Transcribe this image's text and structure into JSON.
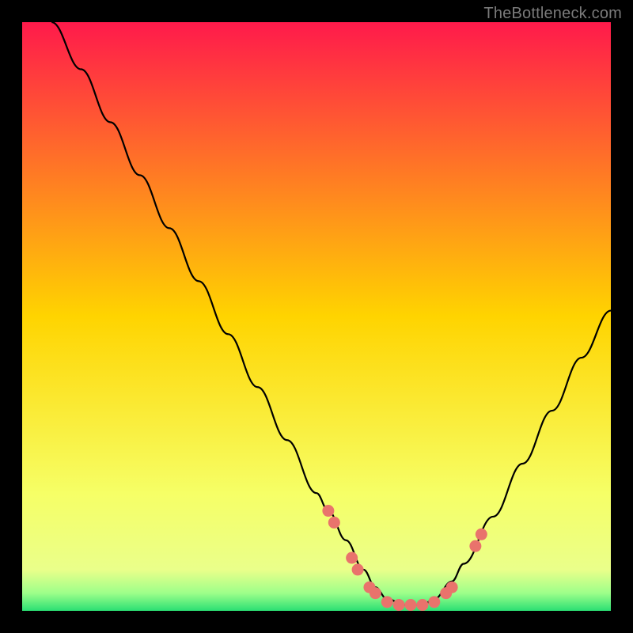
{
  "watermark": "TheBottleneck.com",
  "chart_data": {
    "type": "line",
    "title": "",
    "xlabel": "",
    "ylabel": "",
    "xlim": [
      0,
      100
    ],
    "ylim": [
      0,
      100
    ],
    "gradient_stops": [
      {
        "offset": 0.0,
        "color": "#ff1a4b"
      },
      {
        "offset": 0.5,
        "color": "#ffd400"
      },
      {
        "offset": 0.8,
        "color": "#f6ff66"
      },
      {
        "offset": 0.93,
        "color": "#eaff8a"
      },
      {
        "offset": 0.97,
        "color": "#9dff8a"
      },
      {
        "offset": 1.0,
        "color": "#2bdf74"
      }
    ],
    "series": [
      {
        "name": "bottleneck-curve",
        "x": [
          5,
          10,
          15,
          20,
          25,
          30,
          35,
          40,
          45,
          50,
          52,
          55,
          58,
          60,
          62,
          65,
          68,
          70,
          73,
          75,
          80,
          85,
          90,
          95,
          100
        ],
        "y": [
          100,
          92,
          83,
          74,
          65,
          56,
          47,
          38,
          29,
          20,
          17,
          12,
          7,
          4,
          2,
          1,
          1,
          2,
          5,
          8,
          16,
          25,
          34,
          43,
          51
        ]
      }
    ],
    "markers": {
      "name": "highlight-dots",
      "color": "#e9736c",
      "points": [
        {
          "x": 52,
          "y": 17
        },
        {
          "x": 53,
          "y": 15
        },
        {
          "x": 56,
          "y": 9
        },
        {
          "x": 57,
          "y": 7
        },
        {
          "x": 59,
          "y": 4
        },
        {
          "x": 60,
          "y": 3
        },
        {
          "x": 62,
          "y": 1.5
        },
        {
          "x": 64,
          "y": 1
        },
        {
          "x": 66,
          "y": 1
        },
        {
          "x": 68,
          "y": 1
        },
        {
          "x": 70,
          "y": 1.5
        },
        {
          "x": 72,
          "y": 3
        },
        {
          "x": 73,
          "y": 4
        },
        {
          "x": 77,
          "y": 11
        },
        {
          "x": 78,
          "y": 13
        }
      ]
    }
  }
}
